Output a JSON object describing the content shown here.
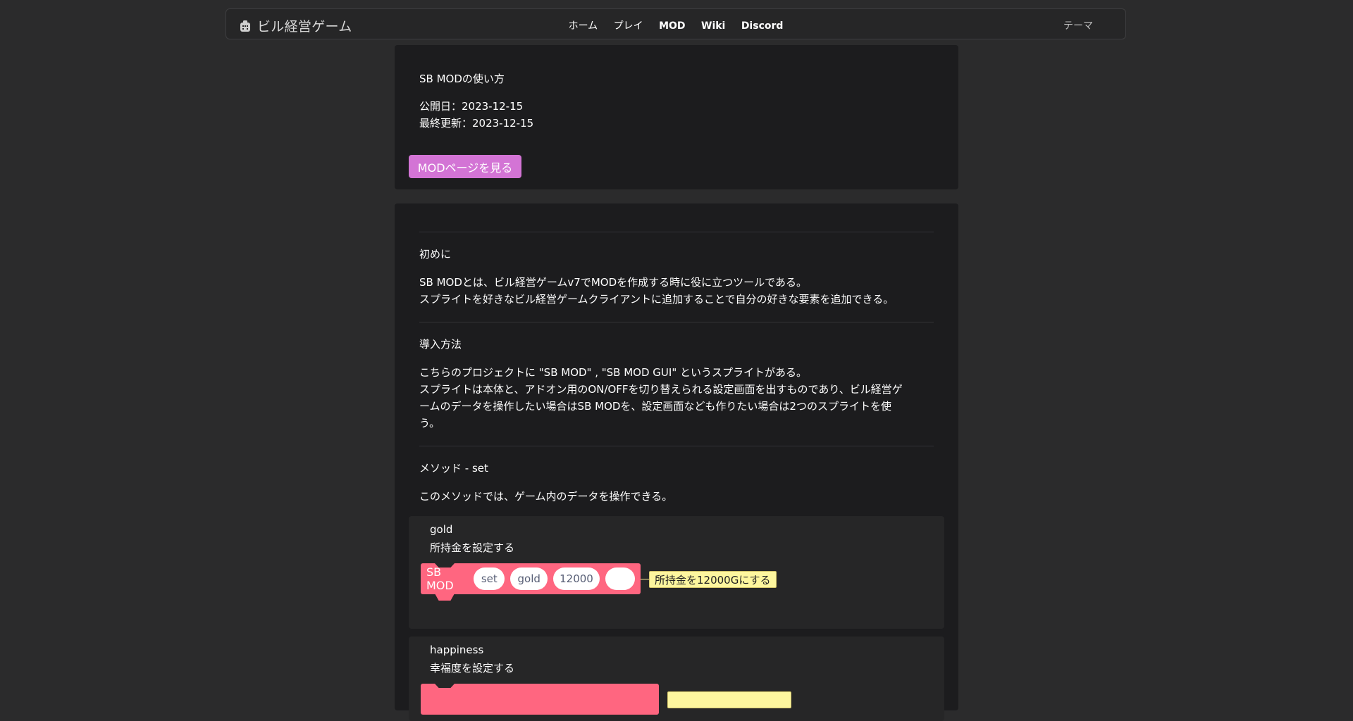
{
  "header": {
    "brand_name": "ビル経営ゲーム",
    "nav": [
      "ホーム",
      "プレイ",
      "MOD",
      "Wiki",
      "Discord"
    ],
    "theme_label": "テーマ"
  },
  "info_card": {
    "title": "SB MODの使い方",
    "published": "公開日：2023-12-15",
    "updated": "最終更新：2023-12-15",
    "mod_button": "MODページを見る"
  },
  "content": {
    "intro_heading": "初めに",
    "intro_line1": "SB MODとは、ビル経営ゲームv7でMODを作成する時に役に立つツールである。",
    "intro_line2": "スプライトを好きなビル経営ゲームクライアントに追加することで自分の好きな要素を追加できる。",
    "install_heading": "導入方法",
    "install_line1": "こちらのプロジェクトに \"SB MOD\" , \"SB MOD GUI\" というスプライトがある。",
    "install_line2": "スプライトは本体と、アドオン用のON/OFFを切り替えられる設定画面を出すものであり、ビル経営ゲ",
    "install_line3": "ームのデータを操作したい場合はSB MODを、設定画面なども作りたい場合は2つのスプライトを使",
    "install_line4": "う。",
    "method_heading": "メソッド - set",
    "method_desc": "このメソッドでは、ゲーム内のデータを操作できる。"
  },
  "methods": [
    {
      "name": "gold",
      "desc": "所持金を設定する",
      "block_label": "SB MOD",
      "args": [
        "set",
        "gold",
        "12000",
        ""
      ],
      "comment": "所持金を12000Gにする"
    },
    {
      "name": "happiness",
      "desc": "幸福度を設定する"
    }
  ],
  "colors": {
    "accent": "#d374d5",
    "block": "#ff6680",
    "comment": "#fdf69e"
  }
}
